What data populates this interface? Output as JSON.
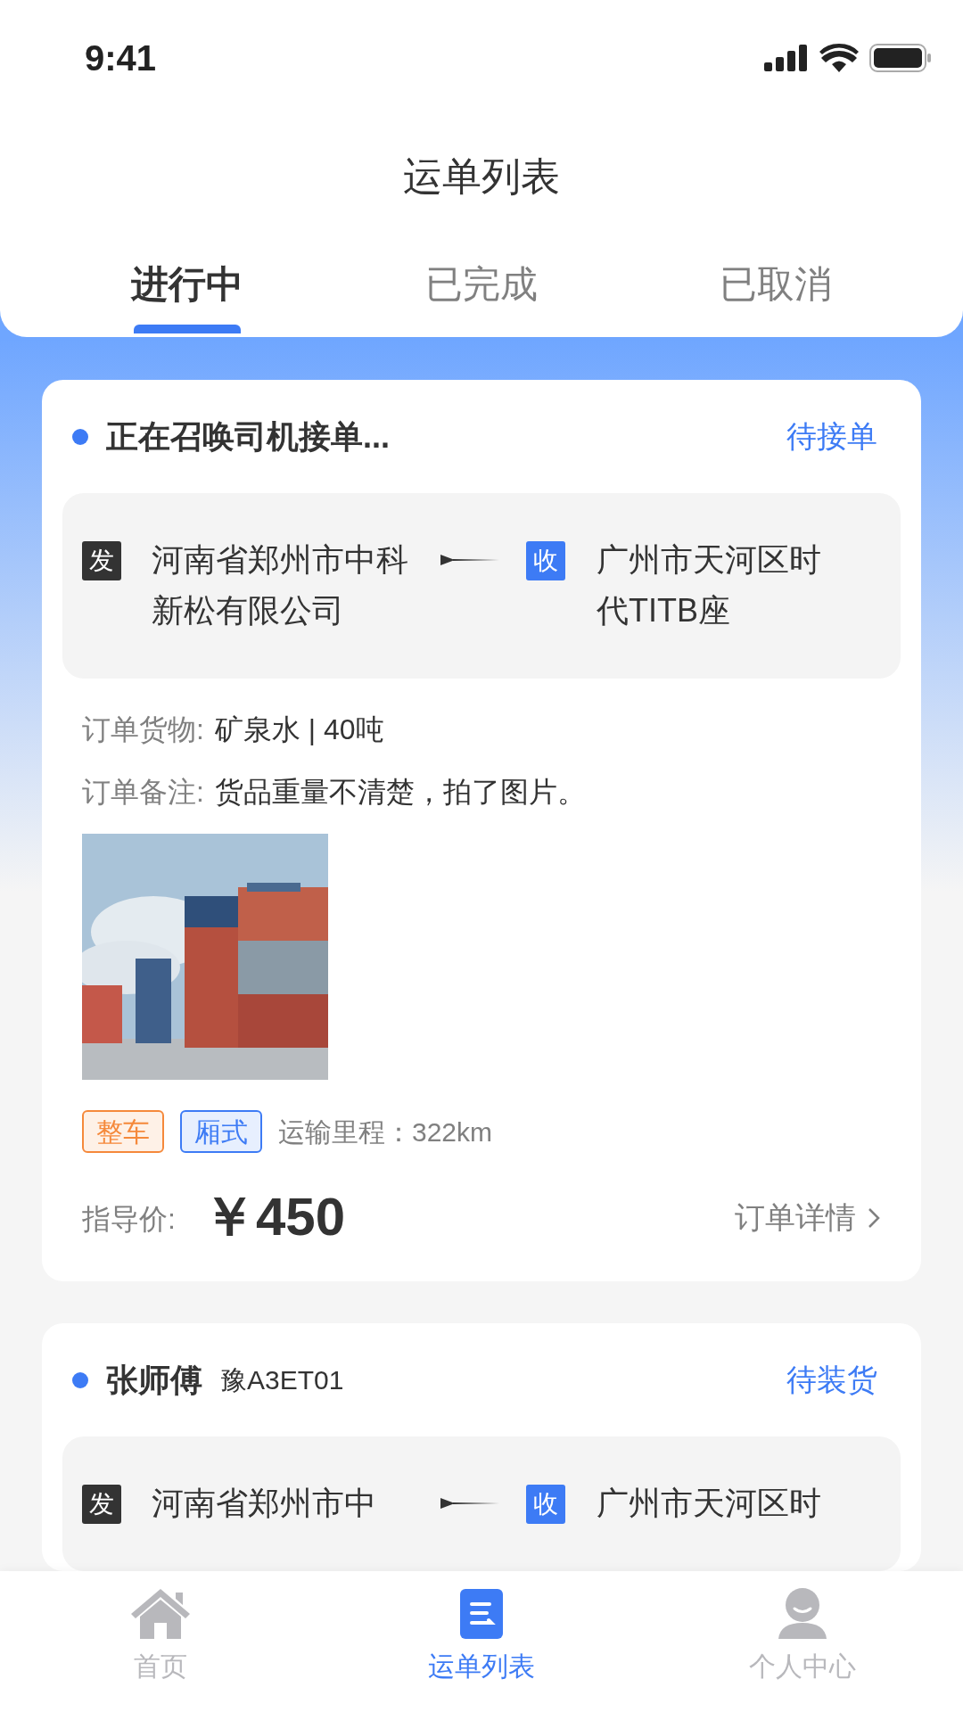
{
  "status_bar": {
    "time": "9:41"
  },
  "title": "运单列表",
  "tabs": [
    {
      "label": "进行中",
      "selected": true
    },
    {
      "label": "已完成",
      "selected": false
    },
    {
      "label": "已取消",
      "selected": false
    }
  ],
  "orders": [
    {
      "kind": "searching",
      "title": "正在召唤司机接单...",
      "status": "待接单",
      "origin_badge": "发",
      "origin": "河南省郑州市中科新松有限公司",
      "destination_badge": "收",
      "destination": "广州市天河区时代TITB座",
      "goods_label": "订单货物:",
      "goods": "矿泉水 | 40吨",
      "note_label": "订单备注:",
      "note": "货品重量不清楚，拍了图片。",
      "photo": {
        "kind": "picture"
      },
      "tags": [
        {
          "label": "整车",
          "color": "#f5893b"
        },
        {
          "label": "厢式",
          "color": "#3d7bf5"
        }
      ],
      "mileage": "运输里程：322km",
      "price_label": "指导价:",
      "price": "￥450",
      "detail_link": "订单详情"
    },
    {
      "kind": "driver",
      "name": "张师傅",
      "plate": "豫A3ET01",
      "status": "待装货",
      "origin_badge": "发",
      "origin": "河南省郑州市中",
      "destination_badge": "收",
      "destination": "广州市天河区时"
    }
  ],
  "nav": [
    {
      "label": "首页",
      "kind": "home",
      "selected": false
    },
    {
      "label": "运单列表",
      "kind": "list",
      "selected": true
    },
    {
      "label": "个人中心",
      "kind": "person",
      "selected": false
    }
  ]
}
